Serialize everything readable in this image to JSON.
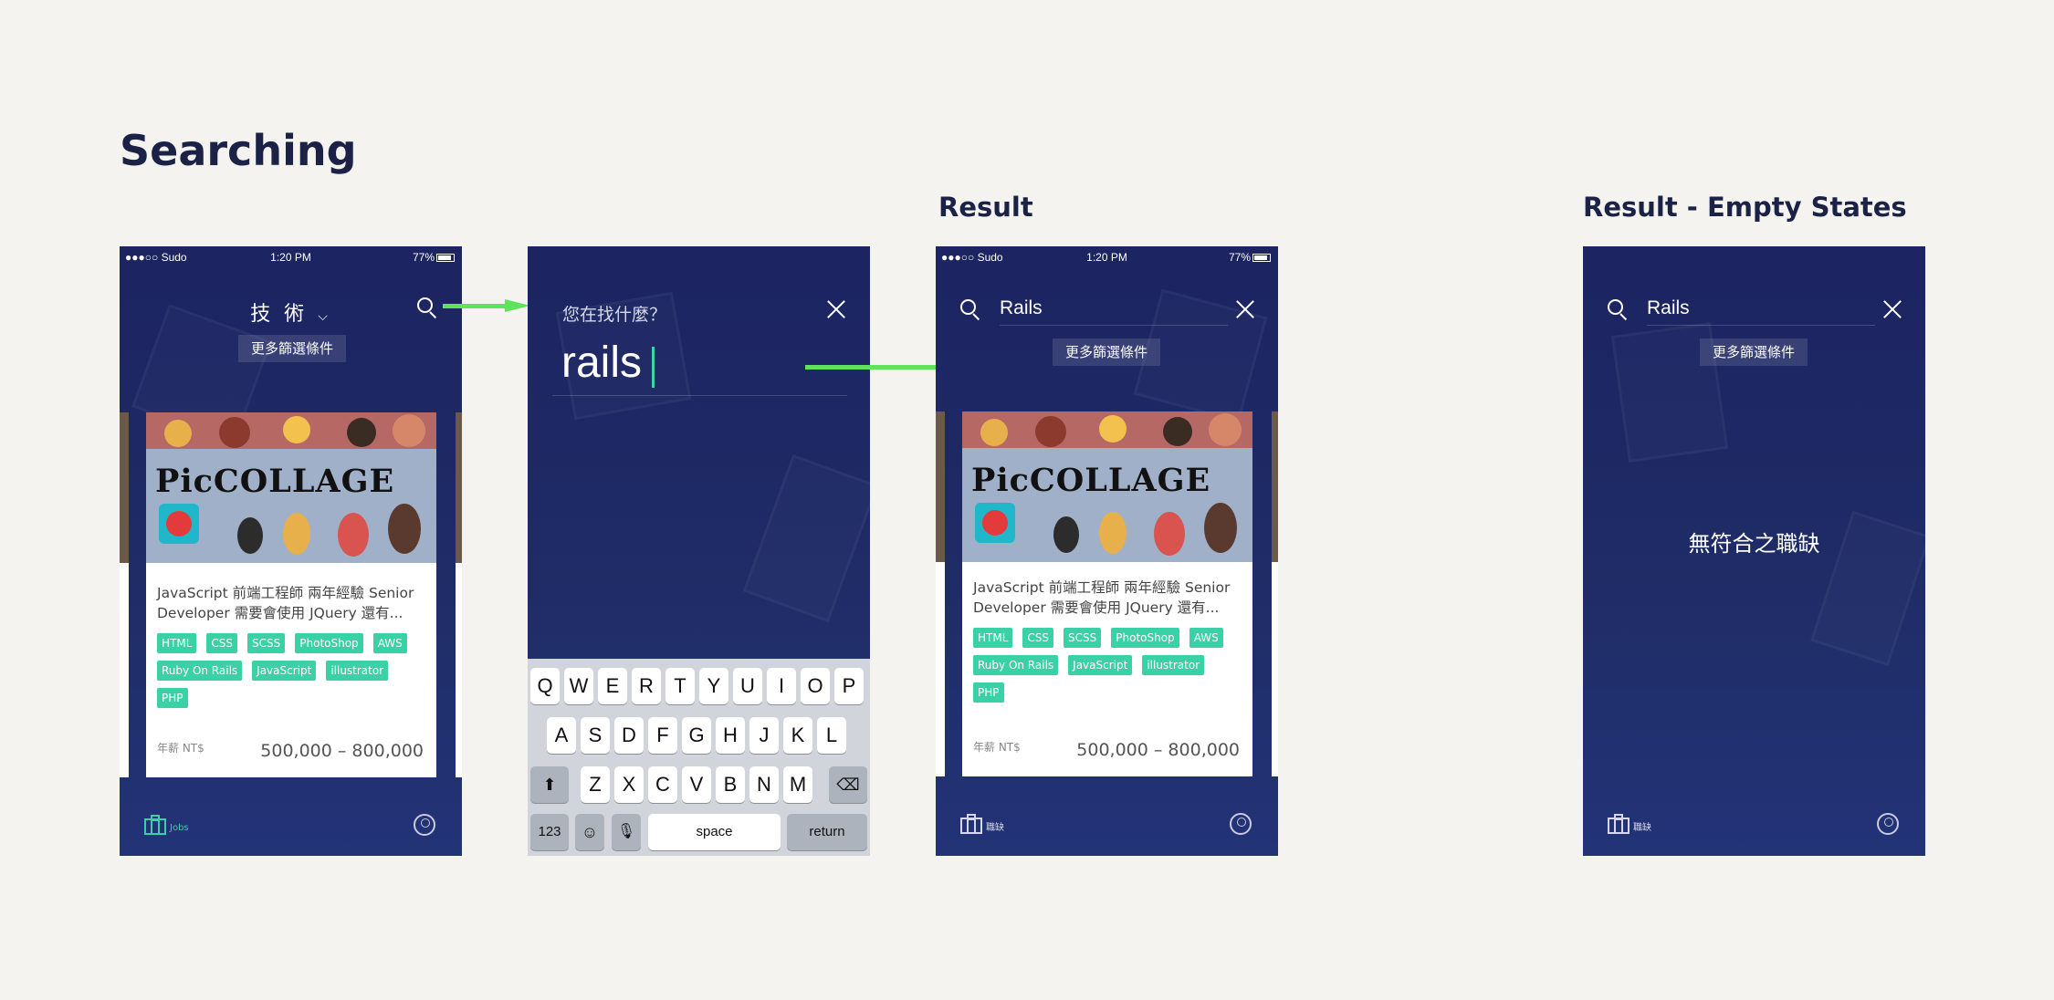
{
  "sections": {
    "main_title": "Searching",
    "result_title": "Result",
    "empty_title": "Result - Empty States"
  },
  "status_bar": {
    "carrier": "●●●○○ Sudo",
    "time": "1:20 PM",
    "battery": "77%"
  },
  "screen1": {
    "category": "技 術",
    "filter_label": "更多篩選條件",
    "tab_jobs_label": "Jobs"
  },
  "screen2": {
    "search_placeholder": "您在找什麼？",
    "query": "rails",
    "keyboard": {
      "row1": [
        "Q",
        "W",
        "E",
        "R",
        "T",
        "Y",
        "U",
        "I",
        "O",
        "P"
      ],
      "row2": [
        "A",
        "S",
        "D",
        "F",
        "G",
        "H",
        "J",
        "K",
        "L"
      ],
      "row3": [
        "Z",
        "X",
        "C",
        "V",
        "B",
        "N",
        "M"
      ],
      "numbers_key": "123",
      "space_key": "space",
      "return_key": "return"
    }
  },
  "screen3": {
    "query": "Rails",
    "filter_label": "更多篩選條件",
    "tab_jobs_label": "職缺"
  },
  "screen4": {
    "query": "Rails",
    "filter_label": "更多篩選條件",
    "empty_message": "無符合之職缺",
    "tab_jobs_label": "職缺"
  },
  "job_card": {
    "image_text": "PicCOLLAGE",
    "description": "JavaScript 前端工程師 兩年經驗 Senior Developer 需要會使用 JQuery 還有...",
    "tags": [
      "HTML",
      "CSS",
      "SCSS",
      "PhotoShop",
      "AWS",
      "Ruby On Rails",
      "JavaScript",
      "illustrator",
      "PHP"
    ],
    "salary_label": "年薪  NT$",
    "salary": "500,000 – 800,000"
  },
  "colors": {
    "background": "#f4f3f0",
    "screen_bg": "#1c2461",
    "accent": "#39d1a5",
    "arrow": "#5ee35a"
  }
}
